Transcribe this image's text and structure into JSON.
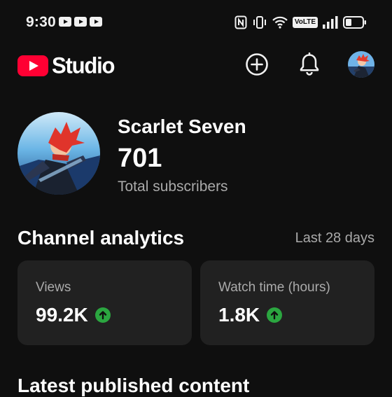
{
  "status_bar": {
    "time": "9:30",
    "network_badge": "VoLTE"
  },
  "header": {
    "app_name": "Studio",
    "brand_color": "#ff0033"
  },
  "channel": {
    "name": "Scarlet Seven",
    "subscriber_count": "701",
    "subscriber_label": "Total subscribers"
  },
  "analytics": {
    "title": "Channel analytics",
    "period": "Last 28 days",
    "cards": [
      {
        "label": "Views",
        "value": "99.2K",
        "trend": "up"
      },
      {
        "label": "Watch time (hours)",
        "value": "1.8K",
        "trend": "up"
      }
    ],
    "trend_up_color": "#2ba640"
  },
  "latest": {
    "title": "Latest published content"
  }
}
